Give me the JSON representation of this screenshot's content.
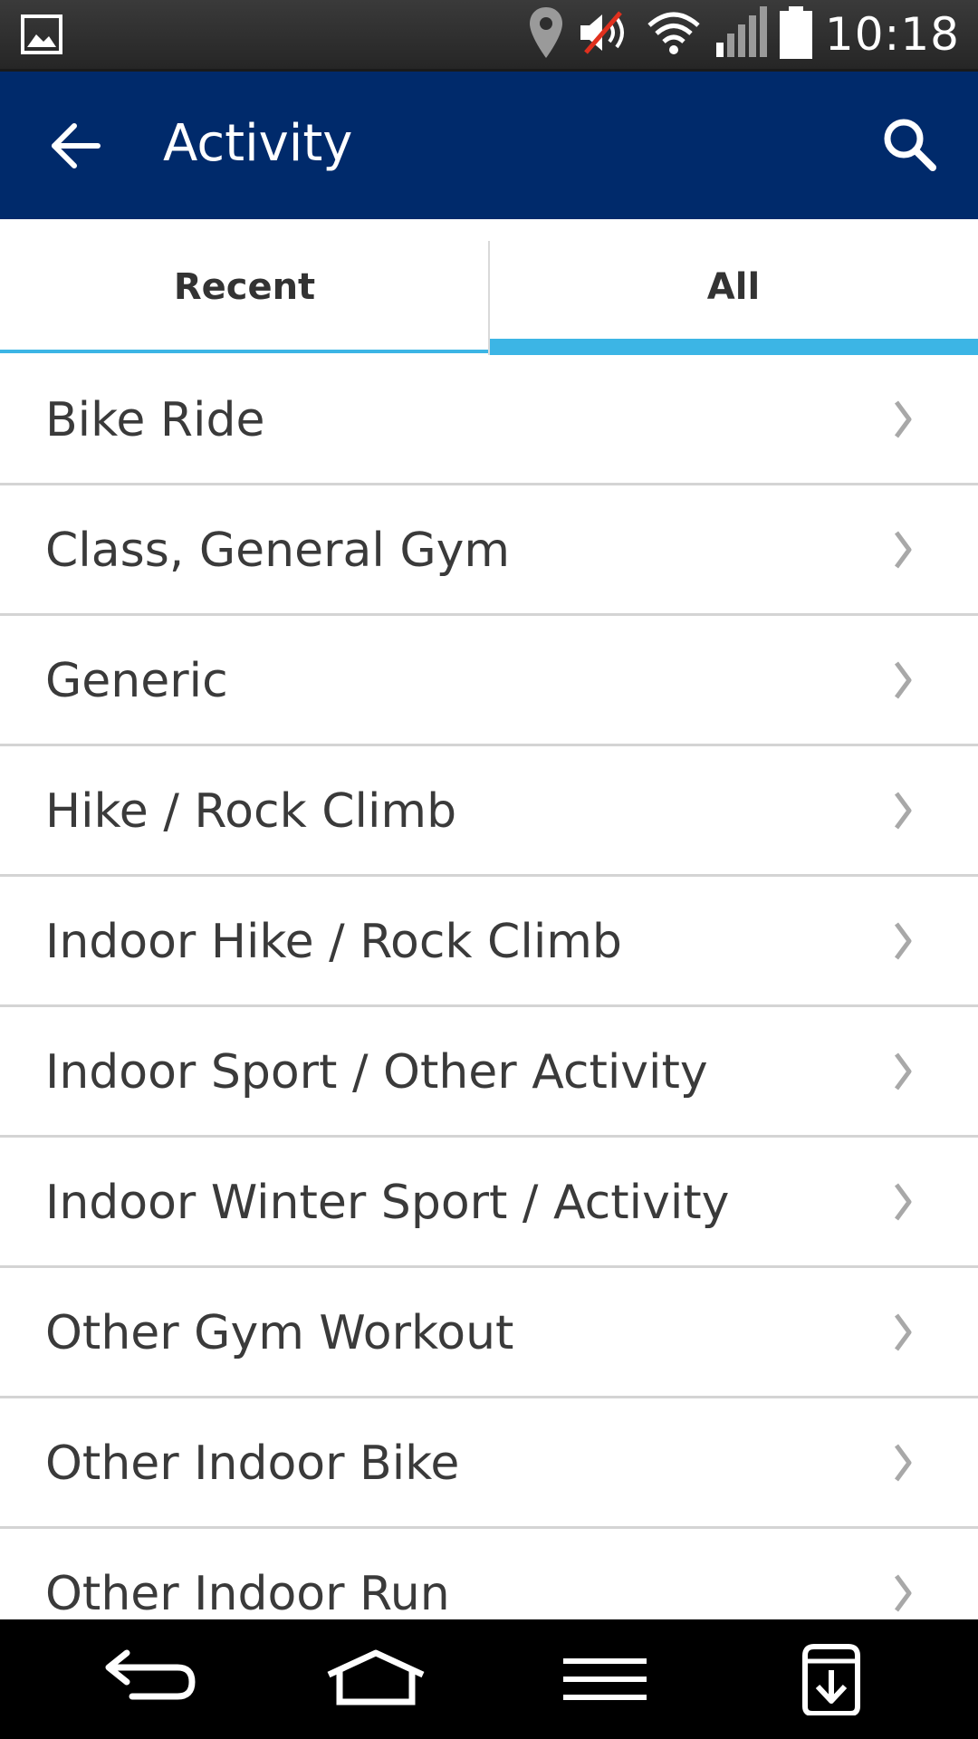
{
  "status_bar": {
    "time": "10:18",
    "icons": [
      "gallery-icon",
      "location-icon",
      "mute-icon",
      "wifi-icon",
      "signal-icon",
      "battery-icon"
    ]
  },
  "app_bar": {
    "title": "Activity",
    "back_icon": "back-arrow-icon",
    "search_icon": "search-icon",
    "background_color": "#002a6b"
  },
  "tabs": [
    {
      "label": "Recent",
      "selected": false
    },
    {
      "label": "All",
      "selected": true
    }
  ],
  "accent_color": "#3cb5e5",
  "activities": [
    {
      "label": "Bike Ride"
    },
    {
      "label": "Class, General Gym"
    },
    {
      "label": "Generic"
    },
    {
      "label": "Hike / Rock Climb"
    },
    {
      "label": "Indoor Hike / Rock Climb"
    },
    {
      "label": "Indoor Sport / Other Activity"
    },
    {
      "label": "Indoor Winter Sport / Activity"
    },
    {
      "label": "Other Gym Workout"
    },
    {
      "label": "Other Indoor Bike"
    },
    {
      "label": "Other Indoor Run"
    }
  ],
  "nav_bar": {
    "buttons": [
      "back-nav-icon",
      "home-nav-icon",
      "menu-nav-icon",
      "download-nav-icon"
    ]
  }
}
